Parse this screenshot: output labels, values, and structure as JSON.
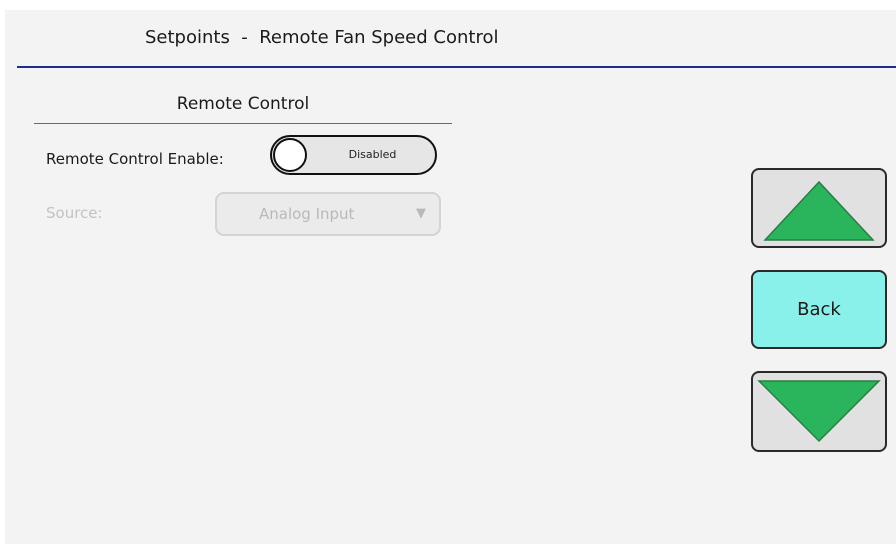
{
  "header": {
    "title": "Setpoints  -  Remote Fan Speed Control"
  },
  "section": {
    "title": "Remote Control"
  },
  "remote_control_enable": {
    "label": "Remote Control Enable:",
    "state_text": "Disabled",
    "enabled": false
  },
  "source": {
    "label": "Source:",
    "value": "Analog Input",
    "arrow": "▼",
    "disabled": true
  },
  "nav": {
    "up_icon": "up-triangle-icon",
    "back_label": "Back",
    "down_icon": "down-triangle-icon"
  },
  "colors": {
    "accent_rule": "#1c2d8c",
    "arrow_fill": "#2ab55c",
    "back_button": "#89f1ea"
  }
}
